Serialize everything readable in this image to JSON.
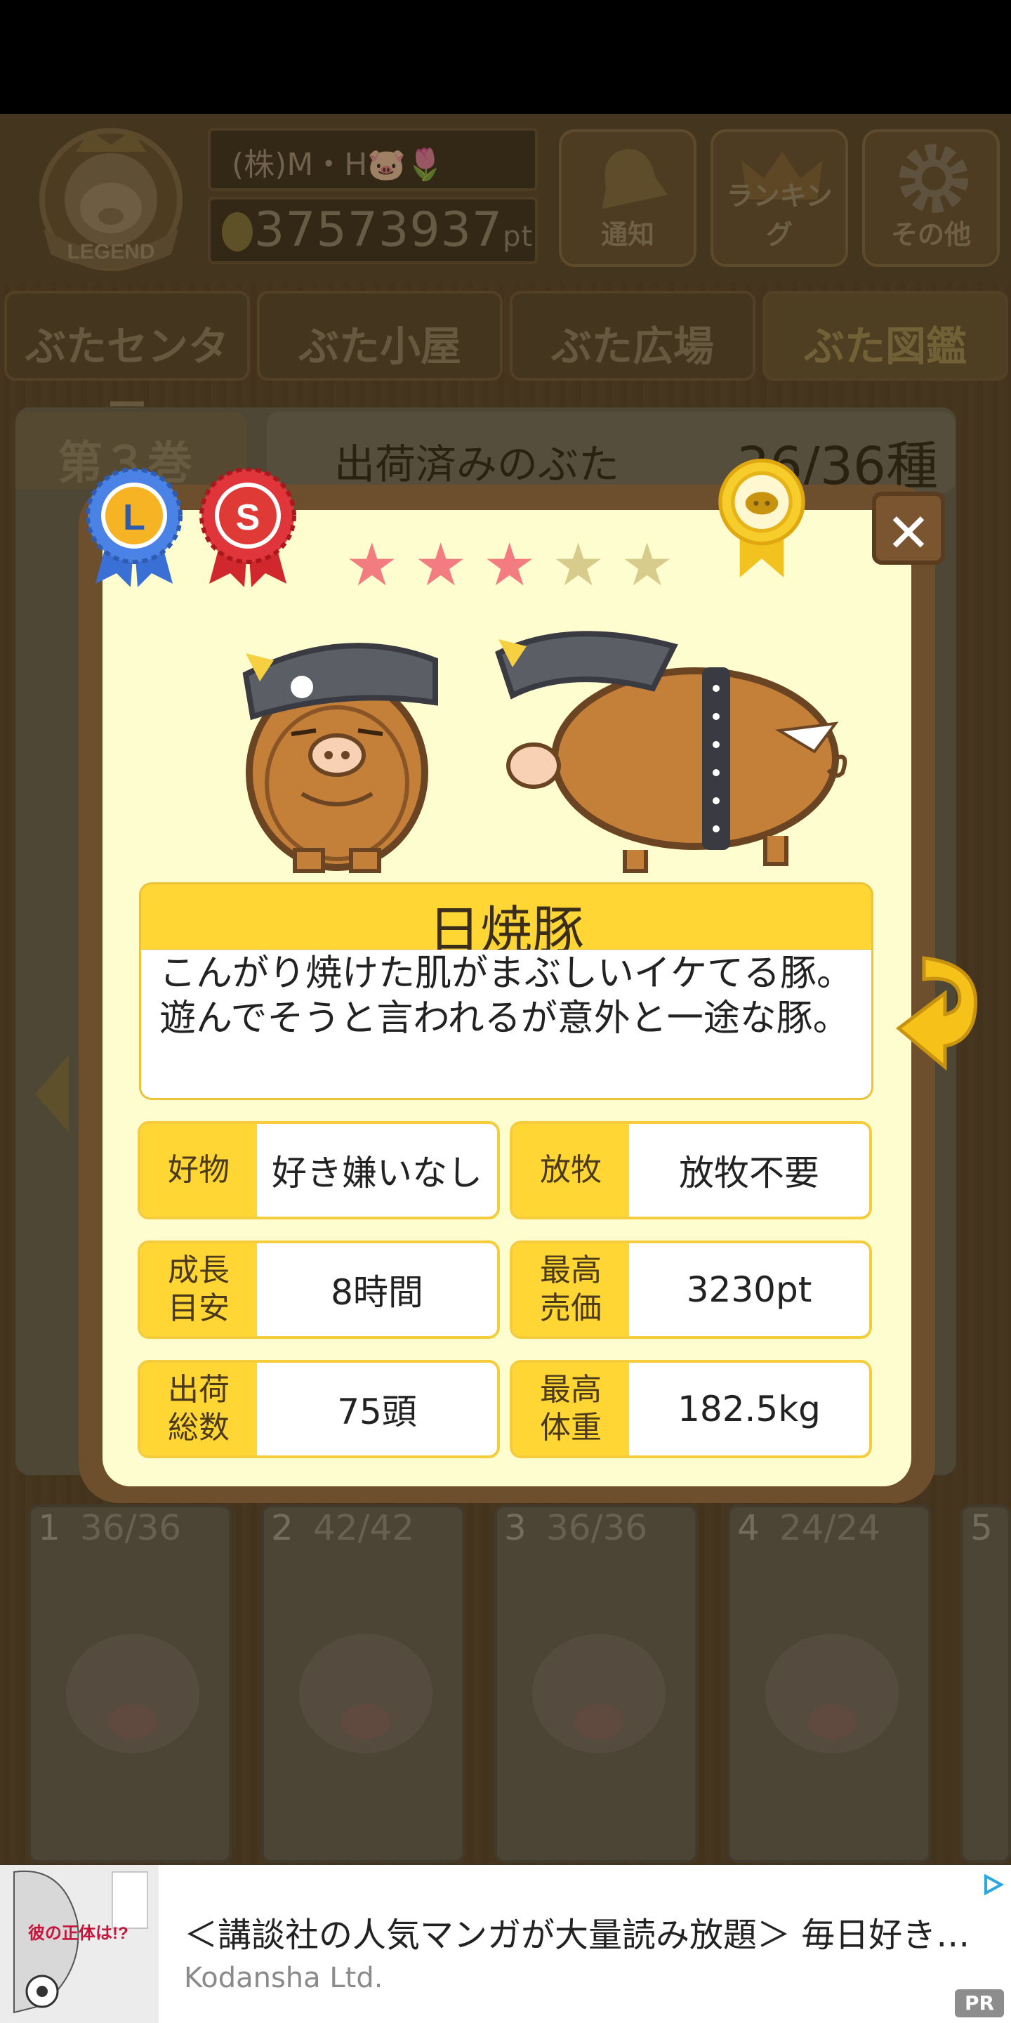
{
  "header": {
    "company_name": "(株)M・H🐷🌷",
    "points": "37573937",
    "points_unit": "pt",
    "buttons": [
      {
        "label": "通知",
        "icon": "bell-icon"
      },
      {
        "label": "ランキング",
        "icon": "crown-icon"
      },
      {
        "label": "その他",
        "icon": "gear-icon"
      }
    ],
    "legend_badge": "LEGEND"
  },
  "tabs": [
    {
      "label": "ぶたセンター"
    },
    {
      "label": "ぶた小屋"
    },
    {
      "label": "ぶた広場"
    },
    {
      "label": "ぶた図鑑",
      "active": true
    }
  ],
  "book": {
    "volume_tab": "第３巻",
    "shipped_label": "出荷済みのぶた",
    "shipped_count": "36/36種",
    "volumes": [
      {
        "num": "1",
        "count": "36/36"
      },
      {
        "num": "2",
        "count": "42/42"
      },
      {
        "num": "3",
        "count": "36/36"
      },
      {
        "num": "4",
        "count": "24/24"
      },
      {
        "num": "5",
        "count": ""
      }
    ]
  },
  "modal": {
    "ribbons": [
      "L",
      "S"
    ],
    "rating": 3,
    "rating_max": 5,
    "pig_name": "日焼豚",
    "description": "こんがり焼けた肌がまぶしいイケてる豚。遊んでそうと言われるが意外と一途な豚。",
    "close_label": "✕",
    "stats": [
      {
        "key": "好物",
        "value": "好き嫌いなし"
      },
      {
        "key": "放牧",
        "value": "放牧不要"
      },
      {
        "key": "成長\n目安",
        "value": "8時間"
      },
      {
        "key": "最高\n売価",
        "value": "3230pt"
      },
      {
        "key": "出荷\n総数",
        "value": "75頭"
      },
      {
        "key": "最高\n体重",
        "value": "182.5kg"
      }
    ]
  },
  "ad": {
    "title": "＜講談社の人気マンガが大量読み放題＞ 毎日好き…",
    "advertiser": "Kodansha Ltd.",
    "pr_label": "PR",
    "thumb_text": "彼の正体は!?"
  },
  "colors": {
    "modal_frame": "#6e4f2d",
    "modal_bg": "#fefdd0",
    "accent_yellow": "#ffd634",
    "star_on": "#f27c80",
    "star_off": "#d8cc8c"
  }
}
